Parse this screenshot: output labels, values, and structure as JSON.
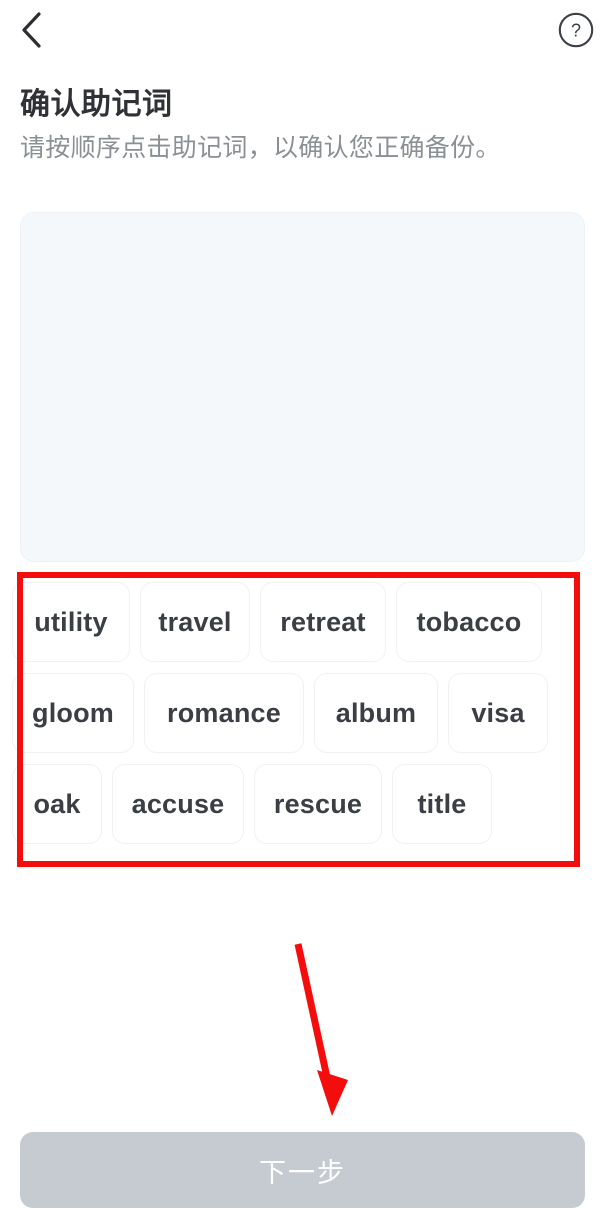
{
  "topbar": {
    "back_icon": "chevron-left-icon",
    "help_icon": "help-circle-icon"
  },
  "header": {
    "title": "确认助记词",
    "subtitle": "请按顺序点击助记词，以确认您正确备份。"
  },
  "answer_panel": {
    "selected_words": [],
    "background_color": "#f5f8fa"
  },
  "word_bank": {
    "words": [
      {
        "label": "utility",
        "class": "w-utility"
      },
      {
        "label": "travel",
        "class": "w-travel"
      },
      {
        "label": "retreat",
        "class": "w-retreat"
      },
      {
        "label": "tobacco",
        "class": "w-tobacco"
      },
      {
        "label": "gloom",
        "class": "w-gloom"
      },
      {
        "label": "romance",
        "class": "w-romance"
      },
      {
        "label": "album",
        "class": "w-album"
      },
      {
        "label": "visa",
        "class": "w-visa"
      },
      {
        "label": "oak",
        "class": "w-oak"
      },
      {
        "label": "accuse",
        "class": "w-accuse"
      },
      {
        "label": "rescue",
        "class": "w-rescue"
      },
      {
        "label": "title",
        "class": "w-title"
      }
    ]
  },
  "footer": {
    "next_label": "下一步",
    "next_enabled": false,
    "next_color": "#c6cad1"
  },
  "annotations": {
    "highlight_box_color": "#f40d0d",
    "arrow_color": "#f40d0d",
    "arrow_name": "red-arrow-to-next-button"
  }
}
